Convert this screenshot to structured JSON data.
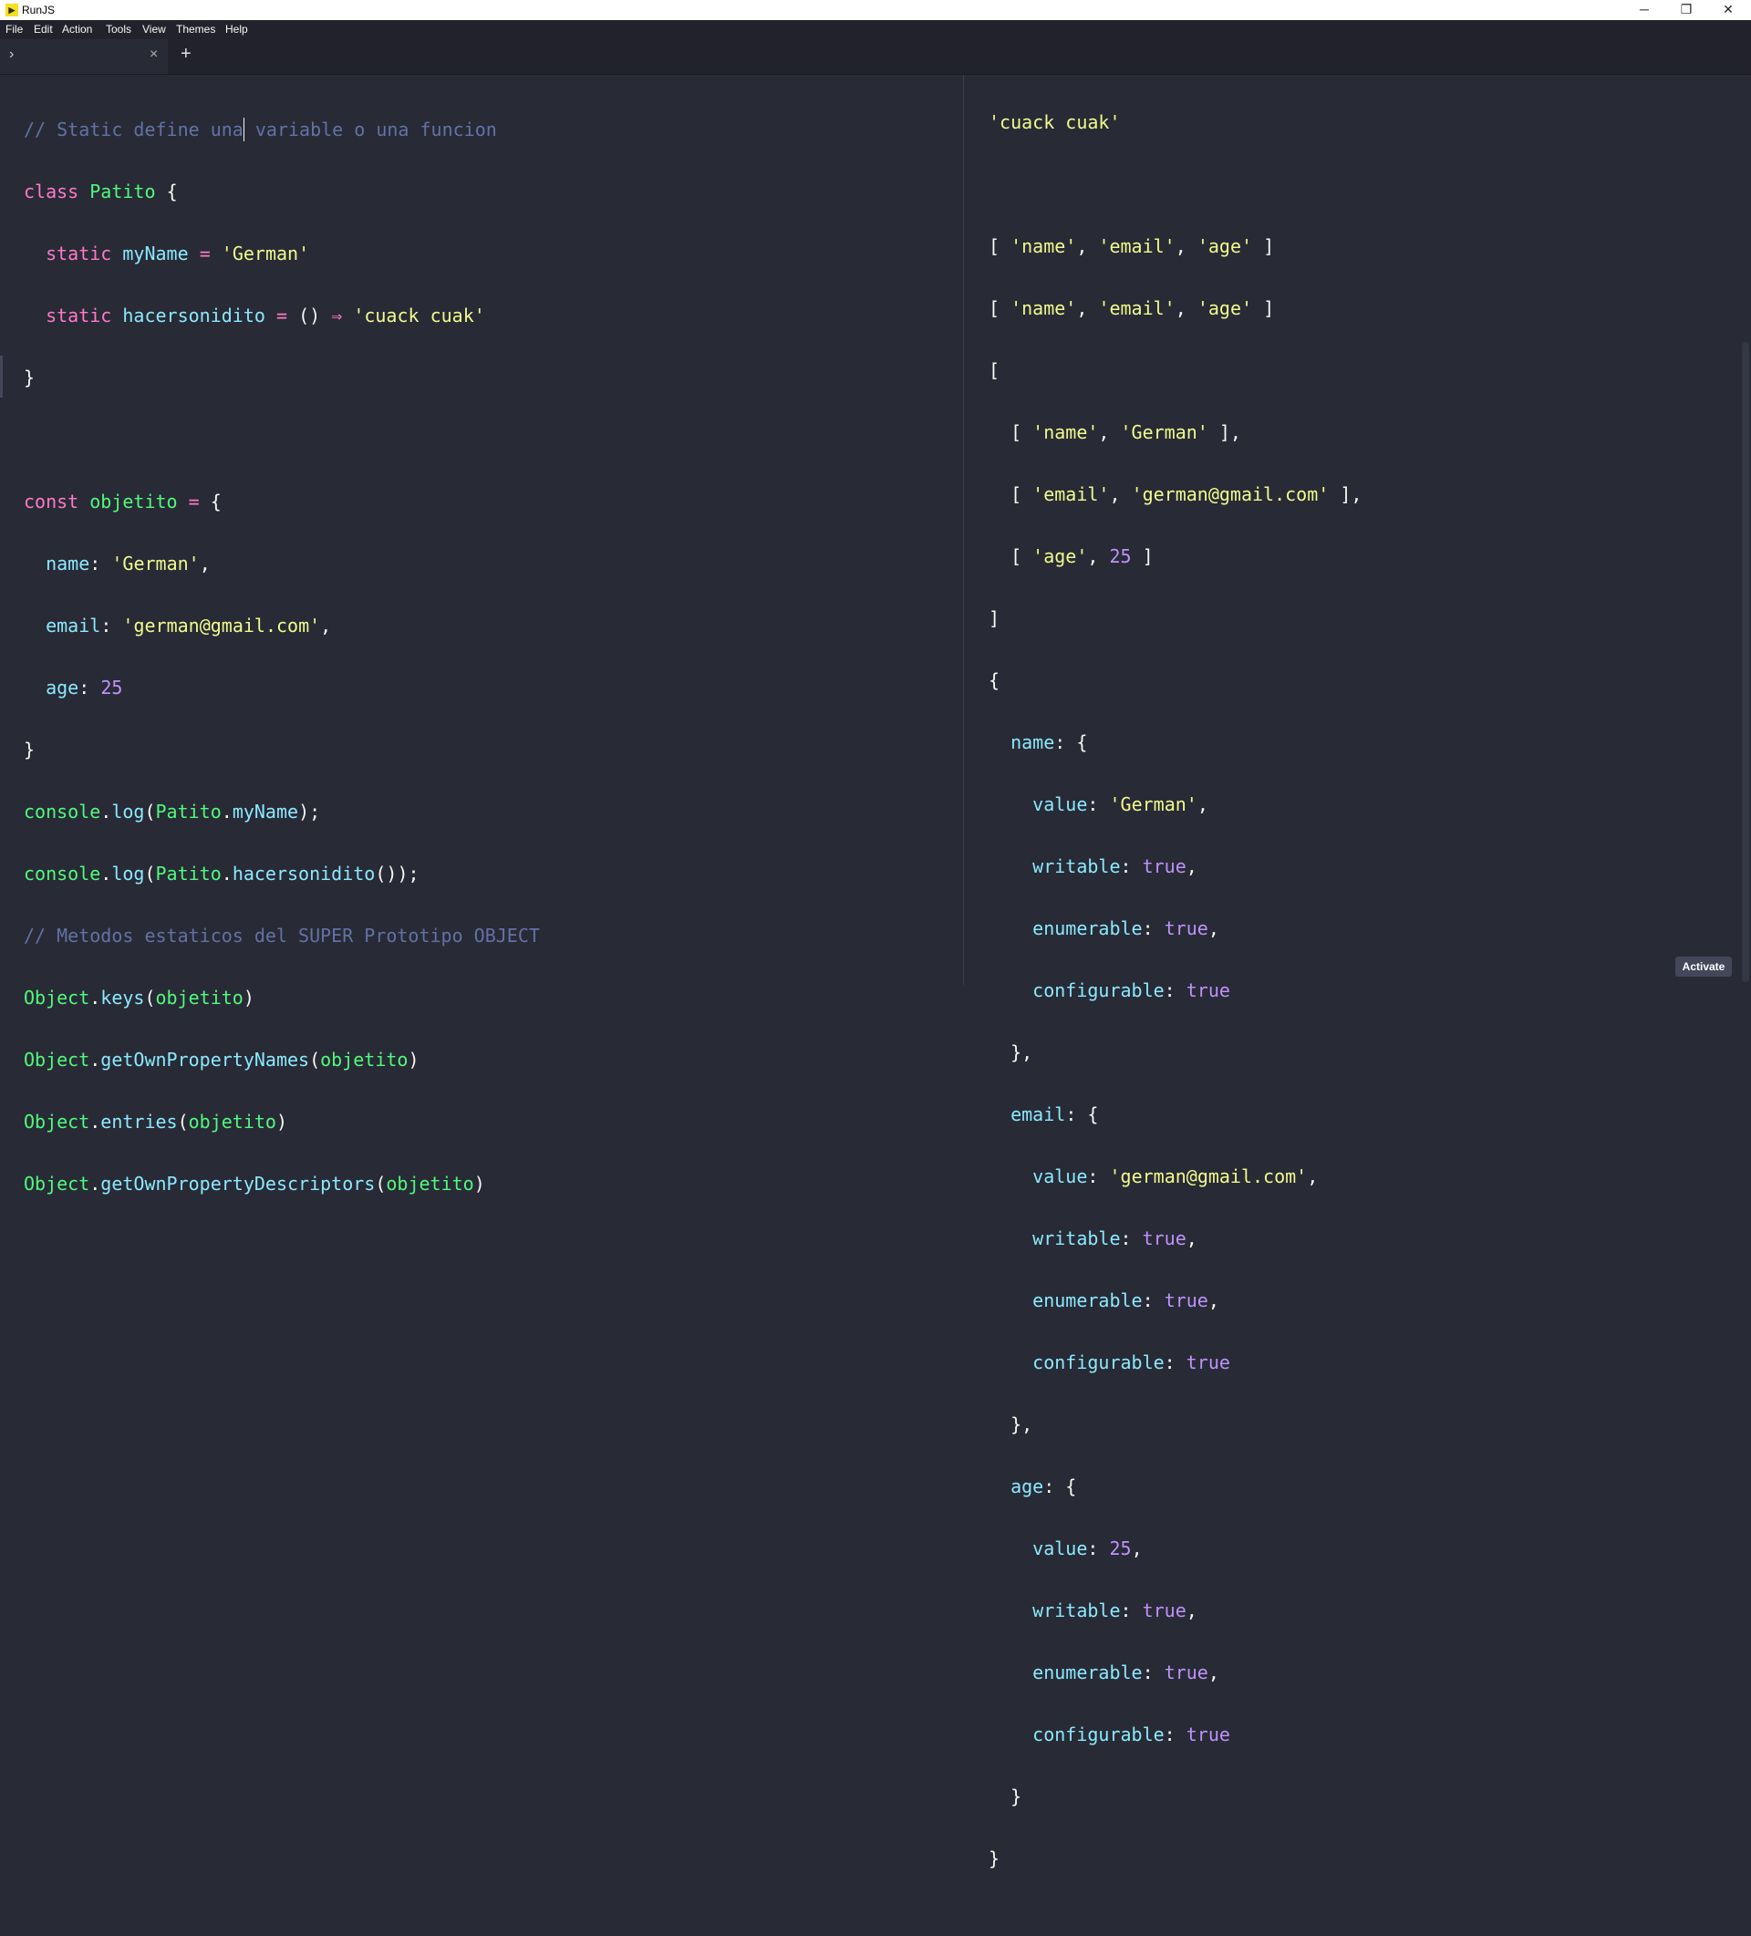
{
  "window": {
    "title": "RunJS",
    "icon": "runjs-icon",
    "minimize": "─",
    "maximize": "❐",
    "close": "✕"
  },
  "menu": [
    "File",
    "Edit",
    "Action",
    "Tools",
    "View",
    "Themes",
    "Help"
  ],
  "tabs": {
    "chevron": "›",
    "close": "×",
    "add": "+"
  },
  "theme_colors": {
    "background": "#282a36",
    "comment": "#6272a4",
    "keyword": "#ff79c6",
    "class": "#50fa7b",
    "string": "#f1fa8c",
    "property": "#8be9fd",
    "number": "#bd93f9"
  },
  "editor": {
    "comment1": "// Static define una",
    "comment1b": " variable o una funcion",
    "kw_class": "class",
    "class_name": "Patito",
    "kw_static": "static",
    "prop_myName": "myName",
    "str_german": "'German'",
    "prop_hacer": "hacersonidito",
    "arrow": "⇒",
    "str_cuack": "'cuack cuak'",
    "kw_const": "const",
    "var_objetito": "objetito",
    "key_name": "name",
    "key_email": "email",
    "str_email": "'german@gmail.com'",
    "key_age": "age",
    "num_25": "25",
    "console": "console",
    "log": "log",
    "comment2": "// Metodos estaticos del SUPER Prototipo OBJECT",
    "object": "Object",
    "keys": "keys",
    "getOwnPropertyNames": "getOwnPropertyNames",
    "entries": "entries",
    "getOwnPropertyDescriptors": "getOwnPropertyDescriptors"
  },
  "output": {
    "cuack": "'cuack cuak'",
    "s_name": "'name'",
    "s_email": "'email'",
    "s_age": "'age'",
    "s_german": "'German'",
    "s_gmail": "'german@gmail.com'",
    "n_25": "25",
    "k_name": "name",
    "k_email": "email",
    "k_age": "age",
    "k_value": "value",
    "k_writable": "writable",
    "k_enumerable": "enumerable",
    "k_configurable": "configurable",
    "v_true": "true"
  },
  "activate_label": "Activate"
}
